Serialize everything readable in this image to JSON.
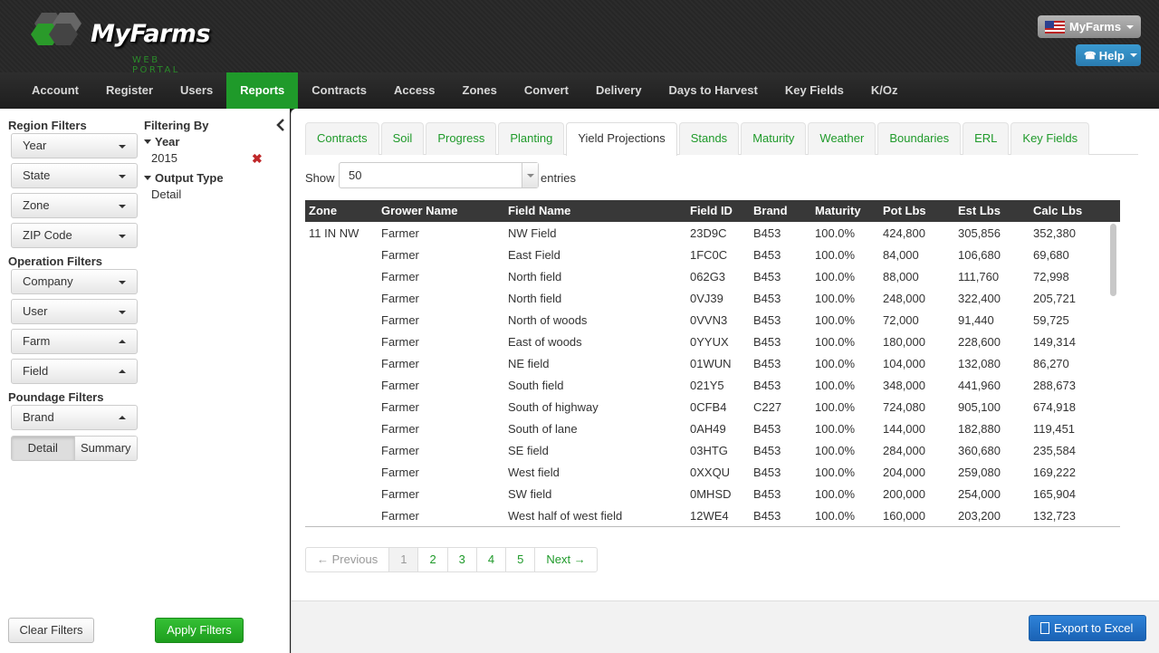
{
  "header": {
    "logo_text": "MyFarms",
    "logo_subtitle": "WEB PORTAL",
    "user_menu": "MyFarms",
    "help": "Help"
  },
  "nav": [
    "Account",
    "Register",
    "Users",
    "Reports",
    "Contracts",
    "Access",
    "Zones",
    "Convert",
    "Delivery",
    "Days to Harvest",
    "Key Fields",
    "K/Oz"
  ],
  "nav_active": "Reports",
  "sidebar": {
    "region_title": "Region Filters",
    "region": [
      "Year",
      "State",
      "Zone",
      "ZIP Code"
    ],
    "operation_title": "Operation Filters",
    "operation": [
      "Company",
      "User",
      "Farm",
      "Field"
    ],
    "poundage_title": "Poundage Filters",
    "poundage": [
      "Brand"
    ],
    "detail_label": "Detail",
    "summary_label": "Summary",
    "filtering_by_title": "Filtering By",
    "filter_year_label": "Year",
    "filter_year_value": "2015",
    "filter_output_label": "Output Type",
    "filter_output_value": "Detail",
    "clear_filters": "Clear Filters",
    "apply_filters": "Apply Filters"
  },
  "tabs": [
    "Contracts",
    "Soil",
    "Progress",
    "Planting",
    "Yield Projections",
    "Stands",
    "Maturity",
    "Weather",
    "Boundaries",
    "ERL",
    "Key Fields"
  ],
  "active_tab": "Yield Projections",
  "table_controls": {
    "show_label": "Show",
    "page_size": "50",
    "entries_label": "entries"
  },
  "table": {
    "columns": [
      "Zone",
      "Grower Name",
      "Field Name",
      "Field ID",
      "Brand",
      "Maturity",
      "Pot Lbs",
      "Est Lbs",
      "Calc Lbs"
    ],
    "rows": [
      [
        "11 IN NW",
        "Farmer",
        "NW Field",
        "23D9C",
        "B453",
        "100.0%",
        "424,800",
        "305,856",
        "352,380"
      ],
      [
        "",
        "Farmer",
        "East Field",
        "1FC0C",
        "B453",
        "100.0%",
        "84,000",
        "106,680",
        "69,680"
      ],
      [
        "",
        "Farmer",
        "North field",
        "062G3",
        "B453",
        "100.0%",
        "88,000",
        "111,760",
        "72,998"
      ],
      [
        "",
        "Farmer",
        "North field",
        "0VJ39",
        "B453",
        "100.0%",
        "248,000",
        "322,400",
        "205,721"
      ],
      [
        "",
        "Farmer",
        "North of woods",
        "0VVN3",
        "B453",
        "100.0%",
        "72,000",
        "91,440",
        "59,725"
      ],
      [
        "",
        "Farmer",
        "East of woods",
        "0YYUX",
        "B453",
        "100.0%",
        "180,000",
        "228,600",
        "149,314"
      ],
      [
        "",
        "Farmer",
        "NE field",
        "01WUN",
        "B453",
        "100.0%",
        "104,000",
        "132,080",
        "86,270"
      ],
      [
        "",
        "Farmer",
        "South field",
        "021Y5",
        "B453",
        "100.0%",
        "348,000",
        "441,960",
        "288,673"
      ],
      [
        "",
        "Farmer",
        "South of highway",
        "0CFB4",
        "C227",
        "100.0%",
        "724,080",
        "905,100",
        "674,918"
      ],
      [
        "",
        "Farmer",
        "South of lane",
        "0AH49",
        "B453",
        "100.0%",
        "144,000",
        "182,880",
        "119,451"
      ],
      [
        "",
        "Farmer",
        "SE field",
        "03HTG",
        "B453",
        "100.0%",
        "284,000",
        "360,680",
        "235,584"
      ],
      [
        "",
        "Farmer",
        "West field",
        "0XXQU",
        "B453",
        "100.0%",
        "204,000",
        "259,080",
        "169,222"
      ],
      [
        "",
        "Farmer",
        "SW field",
        "0MHSD",
        "B453",
        "100.0%",
        "200,000",
        "254,000",
        "165,904"
      ],
      [
        "",
        "Farmer",
        "West half of west field",
        "12WE4",
        "B453",
        "100.0%",
        "160,000",
        "203,200",
        "132,723"
      ]
    ]
  },
  "pagination": {
    "previous": "← Previous",
    "pages": [
      "1",
      "2",
      "3",
      "4",
      "5"
    ],
    "current": "1",
    "next": "Next →"
  },
  "export_label": "Export to Excel",
  "colors": {
    "accent_green": "#1f9a2a",
    "header_dark": "#2a2a2a",
    "table_header": "#383838",
    "export_blue": "#2a72c5"
  }
}
